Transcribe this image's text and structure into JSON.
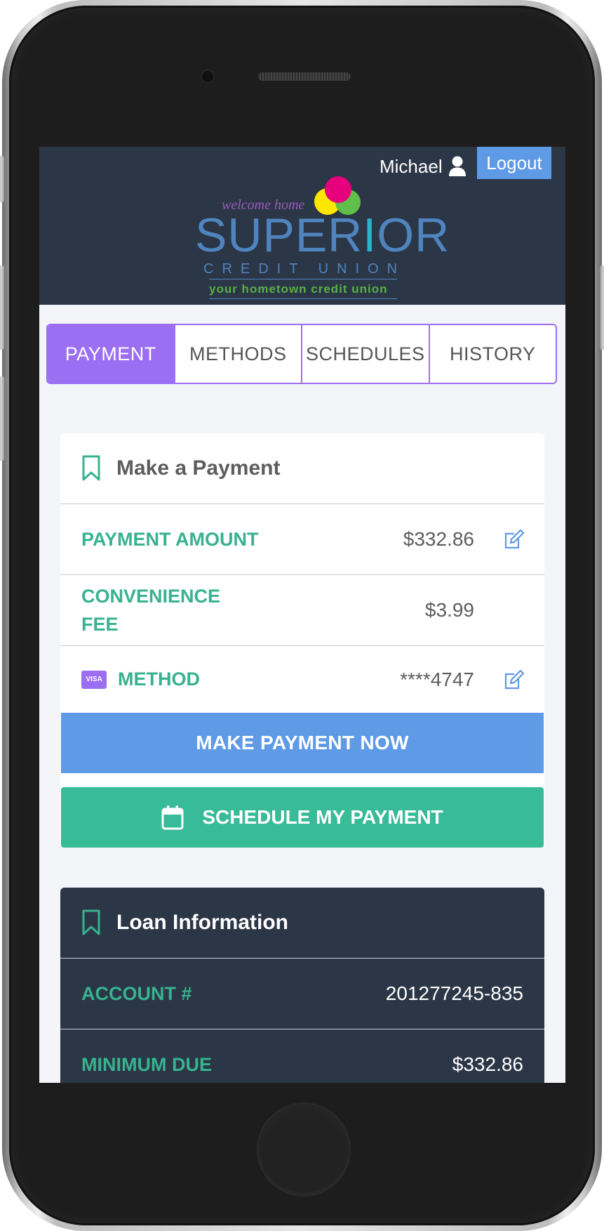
{
  "header": {
    "user_name": "Michael",
    "logout_label": "Logout",
    "logo": {
      "tagline_top": "welcome home",
      "brand": "SUPER",
      "brand_i": "I",
      "brand_end": "OR",
      "subtitle": "CREDIT UNION",
      "tagline": "your hometown credit union",
      "colors": {
        "magenta": "#e6007e",
        "yellow": "#ffe600",
        "green": "#5fbf4a",
        "blue": "#4f84bf"
      }
    }
  },
  "tabs": [
    {
      "label": "PAYMENT",
      "active": true
    },
    {
      "label": "METHODS"
    },
    {
      "label": "SCHEDULES"
    },
    {
      "label": "HISTORY"
    }
  ],
  "payment_card": {
    "title": "Make a Payment",
    "rows": {
      "amount": {
        "label": "PAYMENT AMOUNT",
        "value": "$332.86"
      },
      "fee": {
        "label_line1": "CONVENIENCE",
        "label_line2": "FEE",
        "value": "$3.99"
      },
      "method": {
        "card_brand": "VISA",
        "label": "METHOD",
        "value": "****4747"
      }
    },
    "pay_now_label": "MAKE PAYMENT NOW",
    "schedule_label": "SCHEDULE MY PAYMENT"
  },
  "loan_card": {
    "title": "Loan Information",
    "rows": [
      {
        "label": "ACCOUNT #",
        "value": "201277245-835"
      },
      {
        "label": "MINIMUM DUE",
        "value": "$332.86"
      }
    ]
  },
  "colors": {
    "header_bg": "#2b3646",
    "accent_purple": "#9c6ff2",
    "accent_blue": "#5f9ae6",
    "accent_green": "#38bb98",
    "label_green": "#38b28f"
  }
}
